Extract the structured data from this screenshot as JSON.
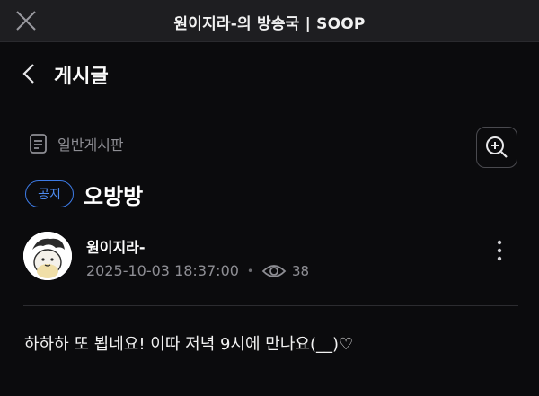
{
  "window": {
    "title": "원이지라-의 방송국 | SOOP"
  },
  "header": {
    "title": "게시글"
  },
  "board": {
    "name": "일반게시판"
  },
  "post": {
    "badge": "공지",
    "title": "오방방",
    "author": "원이지라-",
    "datetime": "2025-10-03 18:37:00",
    "views": "38",
    "body": "하하하 또 뵙네요! 이따 저녁 9시에 만나요(__)♡"
  },
  "colors": {
    "background": "#0b0b0d",
    "topbar": "#1e1e21",
    "badge_blue": "#3d7be6",
    "muted_text": "#8e8e94"
  },
  "icons": [
    "close-icon",
    "chevron-left-icon",
    "document-icon",
    "zoom-in-icon",
    "eye-icon",
    "more-vertical-icon"
  ]
}
